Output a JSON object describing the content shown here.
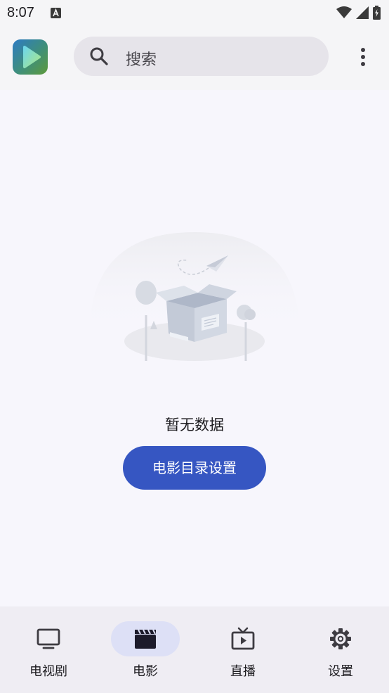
{
  "status_bar": {
    "time": "8:07"
  },
  "search": {
    "placeholder": "搜索"
  },
  "empty_state": {
    "message": "暂无数据",
    "button_label": "电影目录设置"
  },
  "nav": {
    "items": [
      {
        "label": "电视剧",
        "icon": "tv-icon",
        "active": false
      },
      {
        "label": "电影",
        "icon": "clapperboard-icon",
        "active": true
      },
      {
        "label": "直播",
        "icon": "live-tv-icon",
        "active": false
      },
      {
        "label": "设置",
        "icon": "gear-icon",
        "active": false
      }
    ]
  },
  "colors": {
    "accent": "#3656c2",
    "active_pill": "#dde0f6",
    "background": "#f7f6fc",
    "nav_background": "#efedf3",
    "search_background": "#e6e4ea"
  }
}
